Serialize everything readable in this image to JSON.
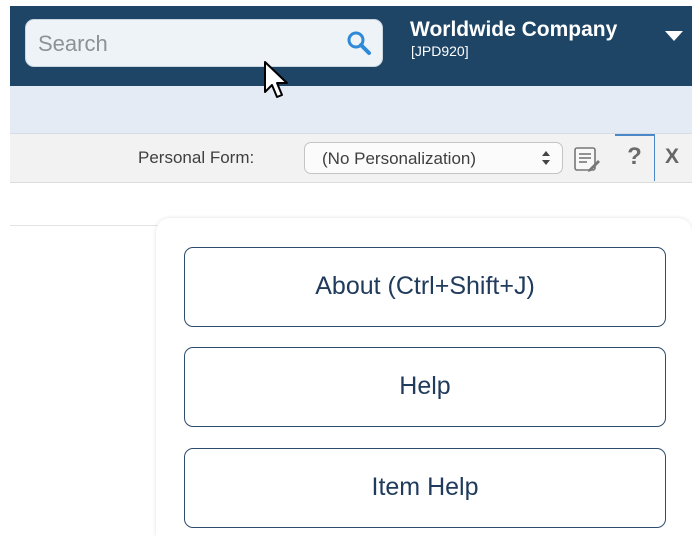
{
  "header": {
    "search": {
      "placeholder": "Search",
      "value": "",
      "icon": "search-icon"
    },
    "company": {
      "name": "Worldwide Company",
      "code": "[JPD920]"
    },
    "colors": {
      "header_bg": "#1f4566",
      "accent": "#2e8ad6"
    }
  },
  "toolbar": {
    "personal_form_label": "Personal Form:",
    "personal_form_value": "(No Personalization)",
    "notes_icon": "notes-icon",
    "help_glyph": "?",
    "close_glyph": "X"
  },
  "help_menu": {
    "items": [
      {
        "label": "About (Ctrl+Shift+J)"
      },
      {
        "label": "Help"
      },
      {
        "label": "Item Help"
      }
    ]
  }
}
